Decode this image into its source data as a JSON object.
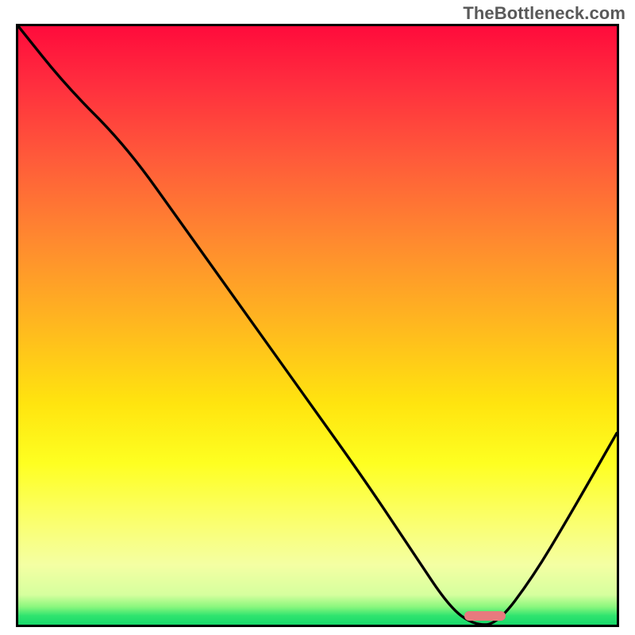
{
  "watermark": "TheBottleneck.com",
  "colors": {
    "curve": "#000000",
    "marker": "#e77a7e",
    "border": "#000000"
  },
  "chart_data": {
    "type": "line",
    "title": "",
    "xlabel": "",
    "ylabel": "",
    "xlim": [
      0,
      100
    ],
    "ylim": [
      0,
      100
    ],
    "background": "gradient(red→green vertical, value encodes bottleneck severity)",
    "series": [
      {
        "name": "bottleneck-curve",
        "x": [
          0,
          8,
          18,
          28,
          38,
          48,
          58,
          66,
          72,
          76,
          80,
          86,
          92,
          100
        ],
        "y": [
          100,
          90,
          80,
          66,
          52,
          38,
          24,
          12,
          3,
          0,
          0,
          8,
          18,
          32
        ]
      }
    ],
    "annotations": [
      {
        "name": "optimal-range-marker",
        "x": 78,
        "y": 1.5
      }
    ],
    "notes": "Axes are unlabelled in the source image; x/y values are read in percent of plot extent. The curve descends from top-left, has a slope break near x≈18, reaches a flat minimum around x≈74–80, then rises toward the right edge."
  }
}
